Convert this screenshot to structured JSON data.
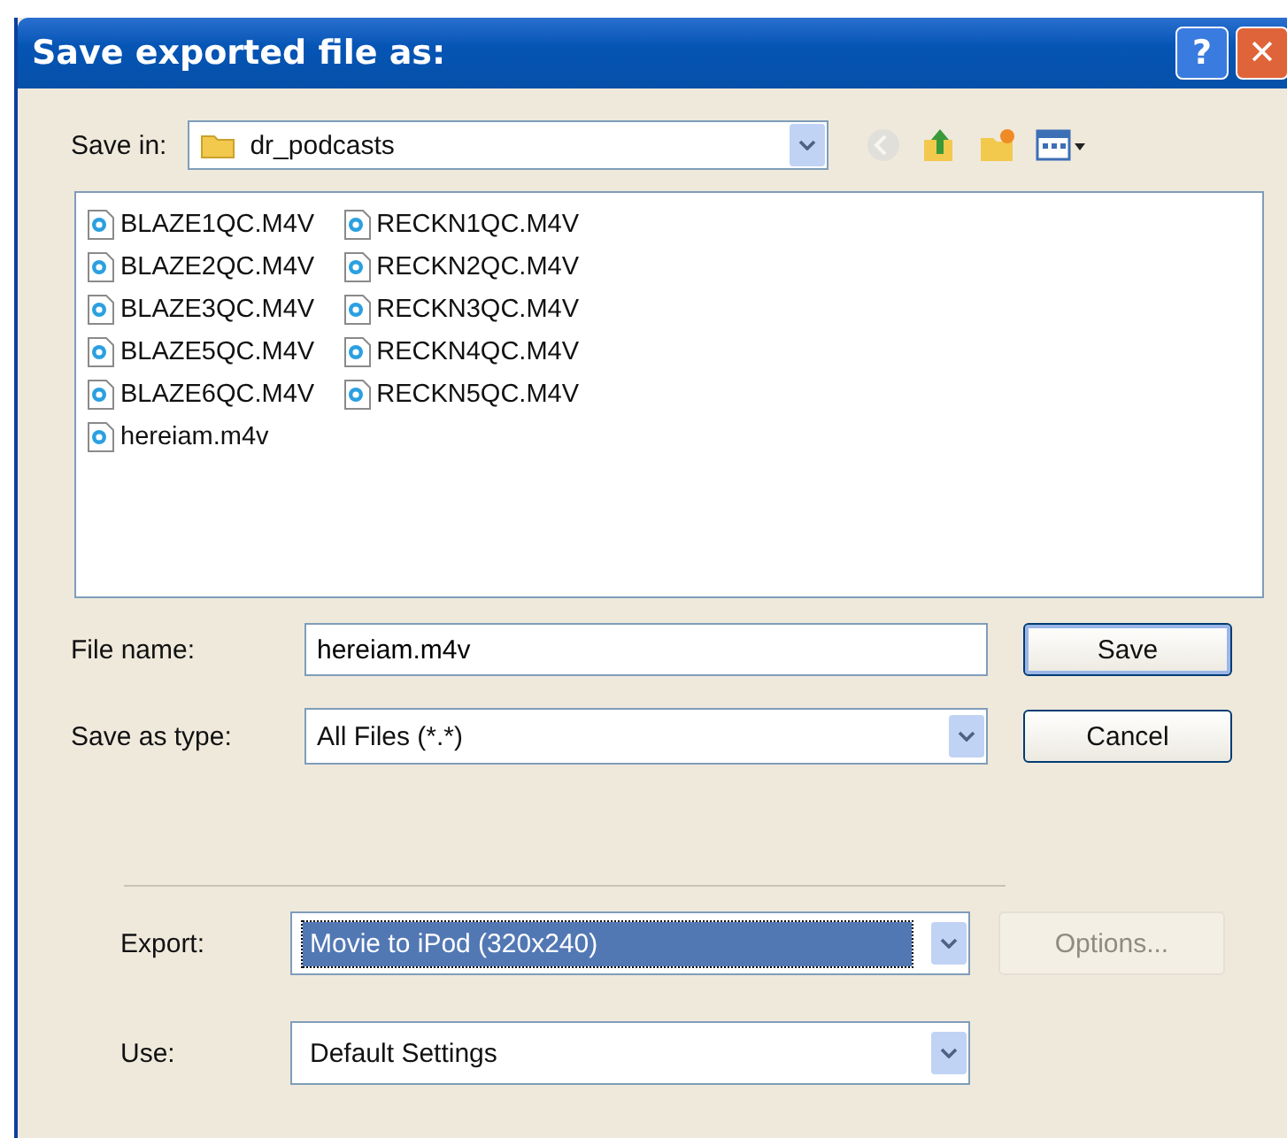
{
  "window": {
    "title": "Save exported file as:",
    "buttons": [
      {
        "kind": "help",
        "label": "?"
      },
      {
        "kind": "close",
        "label": "✕"
      }
    ]
  },
  "save_in": {
    "label": "Save in:",
    "value": "dr_podcasts"
  },
  "toolbar": [
    {
      "kind": "back",
      "disabled": true
    },
    {
      "kind": "up",
      "disabled": false
    },
    {
      "kind": "new-folder",
      "disabled": false
    },
    {
      "kind": "views",
      "disabled": false
    }
  ],
  "files": [
    [
      {
        "name": "BLAZE1QC.M4V"
      },
      {
        "name": "BLAZE2QC.M4V"
      },
      {
        "name": "BLAZE3QC.M4V"
      },
      {
        "name": "BLAZE5QC.M4V"
      },
      {
        "name": "BLAZE6QC.M4V"
      },
      {
        "name": "hereiam.m4v"
      }
    ],
    [
      {
        "name": "RECKN1QC.M4V"
      },
      {
        "name": "RECKN2QC.M4V"
      },
      {
        "name": "RECKN3QC.M4V"
      },
      {
        "name": "RECKN4QC.M4V"
      },
      {
        "name": "RECKN5QC.M4V"
      }
    ]
  ],
  "file_name": {
    "label": "File name:",
    "value": "hereiam.m4v"
  },
  "save_as_type": {
    "label": "Save as type:",
    "value": "All Files (*.*)"
  },
  "buttons": [
    {
      "label": "Save",
      "default": true
    },
    {
      "label": "Cancel",
      "default": false
    }
  ],
  "export": {
    "label": "Export:",
    "value": "Movie to iPod (320x240)",
    "focused": true
  },
  "options_button": {
    "label": "Options...",
    "disabled": true
  },
  "use": {
    "label": "Use:",
    "value": "Default Settings",
    "focused": false
  }
}
